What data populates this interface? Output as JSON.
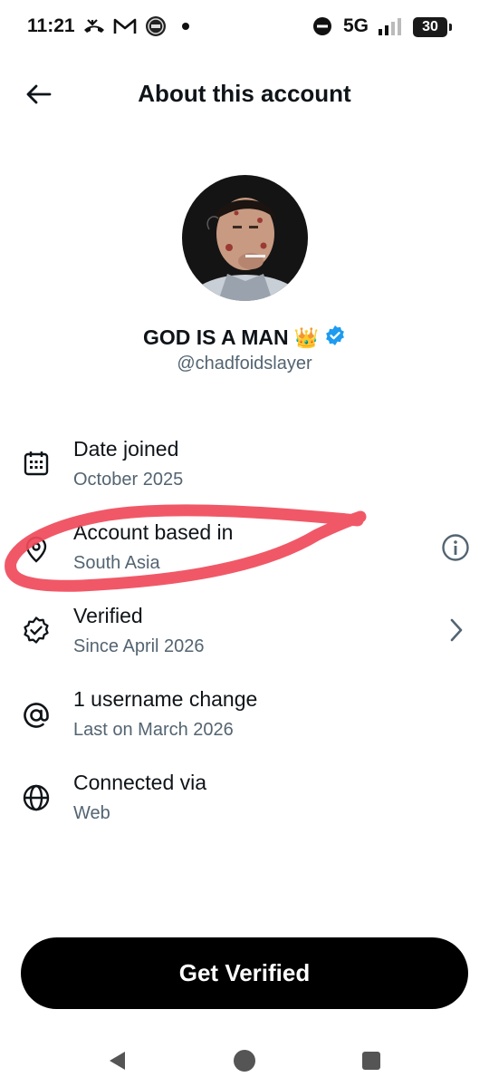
{
  "status_bar": {
    "time": "11:21",
    "network": "5G",
    "battery": "30",
    "icons": [
      "missed-call-icon",
      "gmail-icon",
      "app-notification-icon",
      "dot-icon",
      "do-not-disturb-icon",
      "signal-icon"
    ]
  },
  "header": {
    "title": "About this account",
    "back_icon": "arrow-left-icon"
  },
  "profile": {
    "display_name": "GOD IS A MAN",
    "name_emoji": "👑",
    "verified_badge": "verified-badge-icon",
    "handle": "@chadfoidslayer"
  },
  "rows": [
    {
      "label": "Date joined",
      "value": "October 2025",
      "icon": "calendar-icon"
    },
    {
      "label": "Account based in",
      "value": "South Asia",
      "icon": "location-pin-icon",
      "trailing": "info-icon"
    },
    {
      "label": "Verified",
      "value": "Since April 2026",
      "icon": "verified-outline-icon",
      "trailing": "chevron-right-icon"
    },
    {
      "label": "1 username change",
      "value": "Last on March 2026",
      "icon": "at-sign-icon"
    },
    {
      "label": "Connected via",
      "value": "Web",
      "icon": "globe-icon"
    }
  ],
  "cta": {
    "label": "Get Verified"
  },
  "colors": {
    "text_primary": "#0f1419",
    "text_secondary": "#536471",
    "verified_blue": "#1d9bf0",
    "annotation_red": "#f04a5a",
    "button_bg": "#000000"
  }
}
